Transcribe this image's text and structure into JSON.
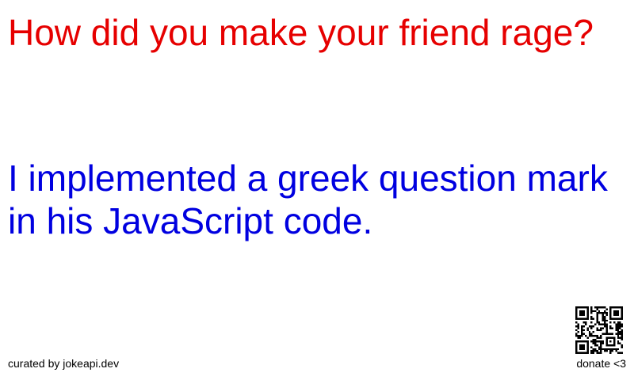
{
  "joke": {
    "setup": "How did you make your friend rage?",
    "delivery": "I implemented a greek question mark in his JavaScript code."
  },
  "footer": {
    "credit": "curated by jokeapi.dev",
    "donate": "donate <3"
  },
  "colors": {
    "setup": "#e60000",
    "delivery": "#0000e0",
    "background": "#ffffff",
    "text": "#000000"
  },
  "icons": {
    "qr": "qr-code-icon"
  }
}
